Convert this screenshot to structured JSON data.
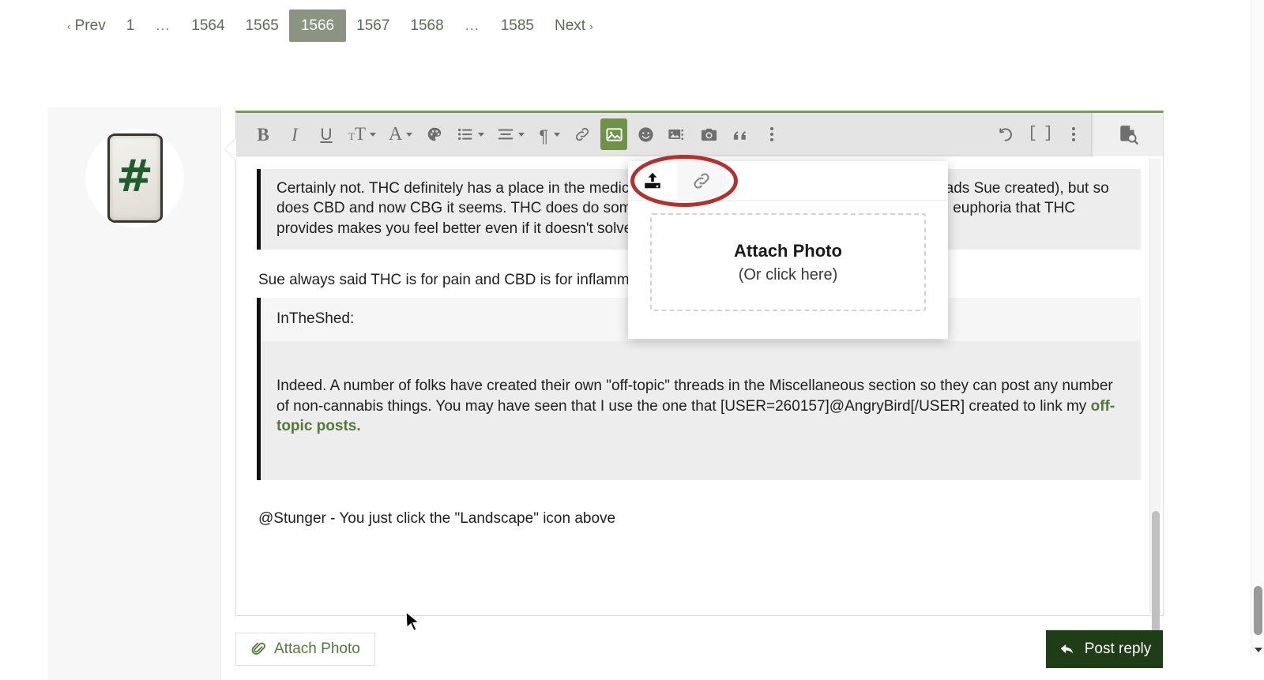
{
  "pagination": {
    "prev": {
      "label": "Prev",
      "arrow": "‹",
      "icon": "chevron-left-icon"
    },
    "next": {
      "label": "Next",
      "arrow": "›",
      "icon": "chevron-right-icon"
    },
    "items": [
      {
        "label": "1",
        "type": "link"
      },
      {
        "label": "…",
        "type": "dots"
      },
      {
        "label": "1564",
        "type": "link"
      },
      {
        "label": "1565",
        "type": "link"
      },
      {
        "label": "1566",
        "type": "current"
      },
      {
        "label": "1567",
        "type": "link"
      },
      {
        "label": "1568",
        "type": "link"
      },
      {
        "label": "…",
        "type": "dots"
      },
      {
        "label": "1585",
        "type": "link"
      }
    ],
    "current_page": "1566"
  },
  "avatar": {
    "icon": "mahjong-tile-avatar",
    "glyph": "#"
  },
  "toolbar": {
    "bold": "B",
    "italic": "I",
    "underline": "U",
    "font_size_small": "T",
    "font_size_big": "T",
    "text_color": "A",
    "palette_icon": "palette-icon",
    "list_icon": "bullet-list-icon",
    "align_icon": "align-icon",
    "paragraph": "¶",
    "link_icon": "link-icon",
    "image_icon": "insert-image-icon",
    "smiley_icon": "smiley-icon",
    "media_icon": "media-gallery-icon",
    "camera_icon": "camera-icon",
    "quote_icon": "quote-icon",
    "more_icon": "more-vertical-icon",
    "undo_icon": "undo-icon",
    "bbcode": "[ ]",
    "more_right_icon": "more-vertical-icon",
    "preview_icon": "preview-document-icon"
  },
  "content": {
    "quote_one": "Certainly not.  THC definitely has a place in the medicine cabinet (as is evidenced by the multiple threads Sue created), but so does CBD and now CBG it seems.  THC does do something where another cannabinoid does, but the euphoria that THC provides makes you feel better even if it doesn't solve it.",
    "paragraph_one": "Sue always said THC is for pain and CBD is for inflammation.",
    "quote_two_author": "InTheShed:",
    "quote_two_text": "Indeed. A number of folks have created their own \"off-topic\" threads in the Miscellaneous section so they can post any number of non-cannabis things.  You may have seen that I use the one that [USER=260157]@AngryBird[/USER] created to link my ",
    "quote_two_link": "off-topic posts.",
    "paragraph_two": "@Stunger - You just click the \"Landscape\" icon above"
  },
  "attach_popup": {
    "upload_tab_icon": "upload-icon",
    "link_tab_icon": "link-icon",
    "dropzone_title": "Attach Photo",
    "dropzone_subtitle": "(Or click here)"
  },
  "footer": {
    "attach_label": "Attach Photo",
    "attach_icon": "paperclip-icon",
    "post_label": "Post reply",
    "post_icon": "reply-arrow-icon"
  },
  "colors": {
    "accent_green": "#4f7a3a",
    "toolbar_active": "#6f9148",
    "post_button": "#1f3d17",
    "pagination_current": "#8a9480",
    "annotation_red": "#b1312c"
  }
}
